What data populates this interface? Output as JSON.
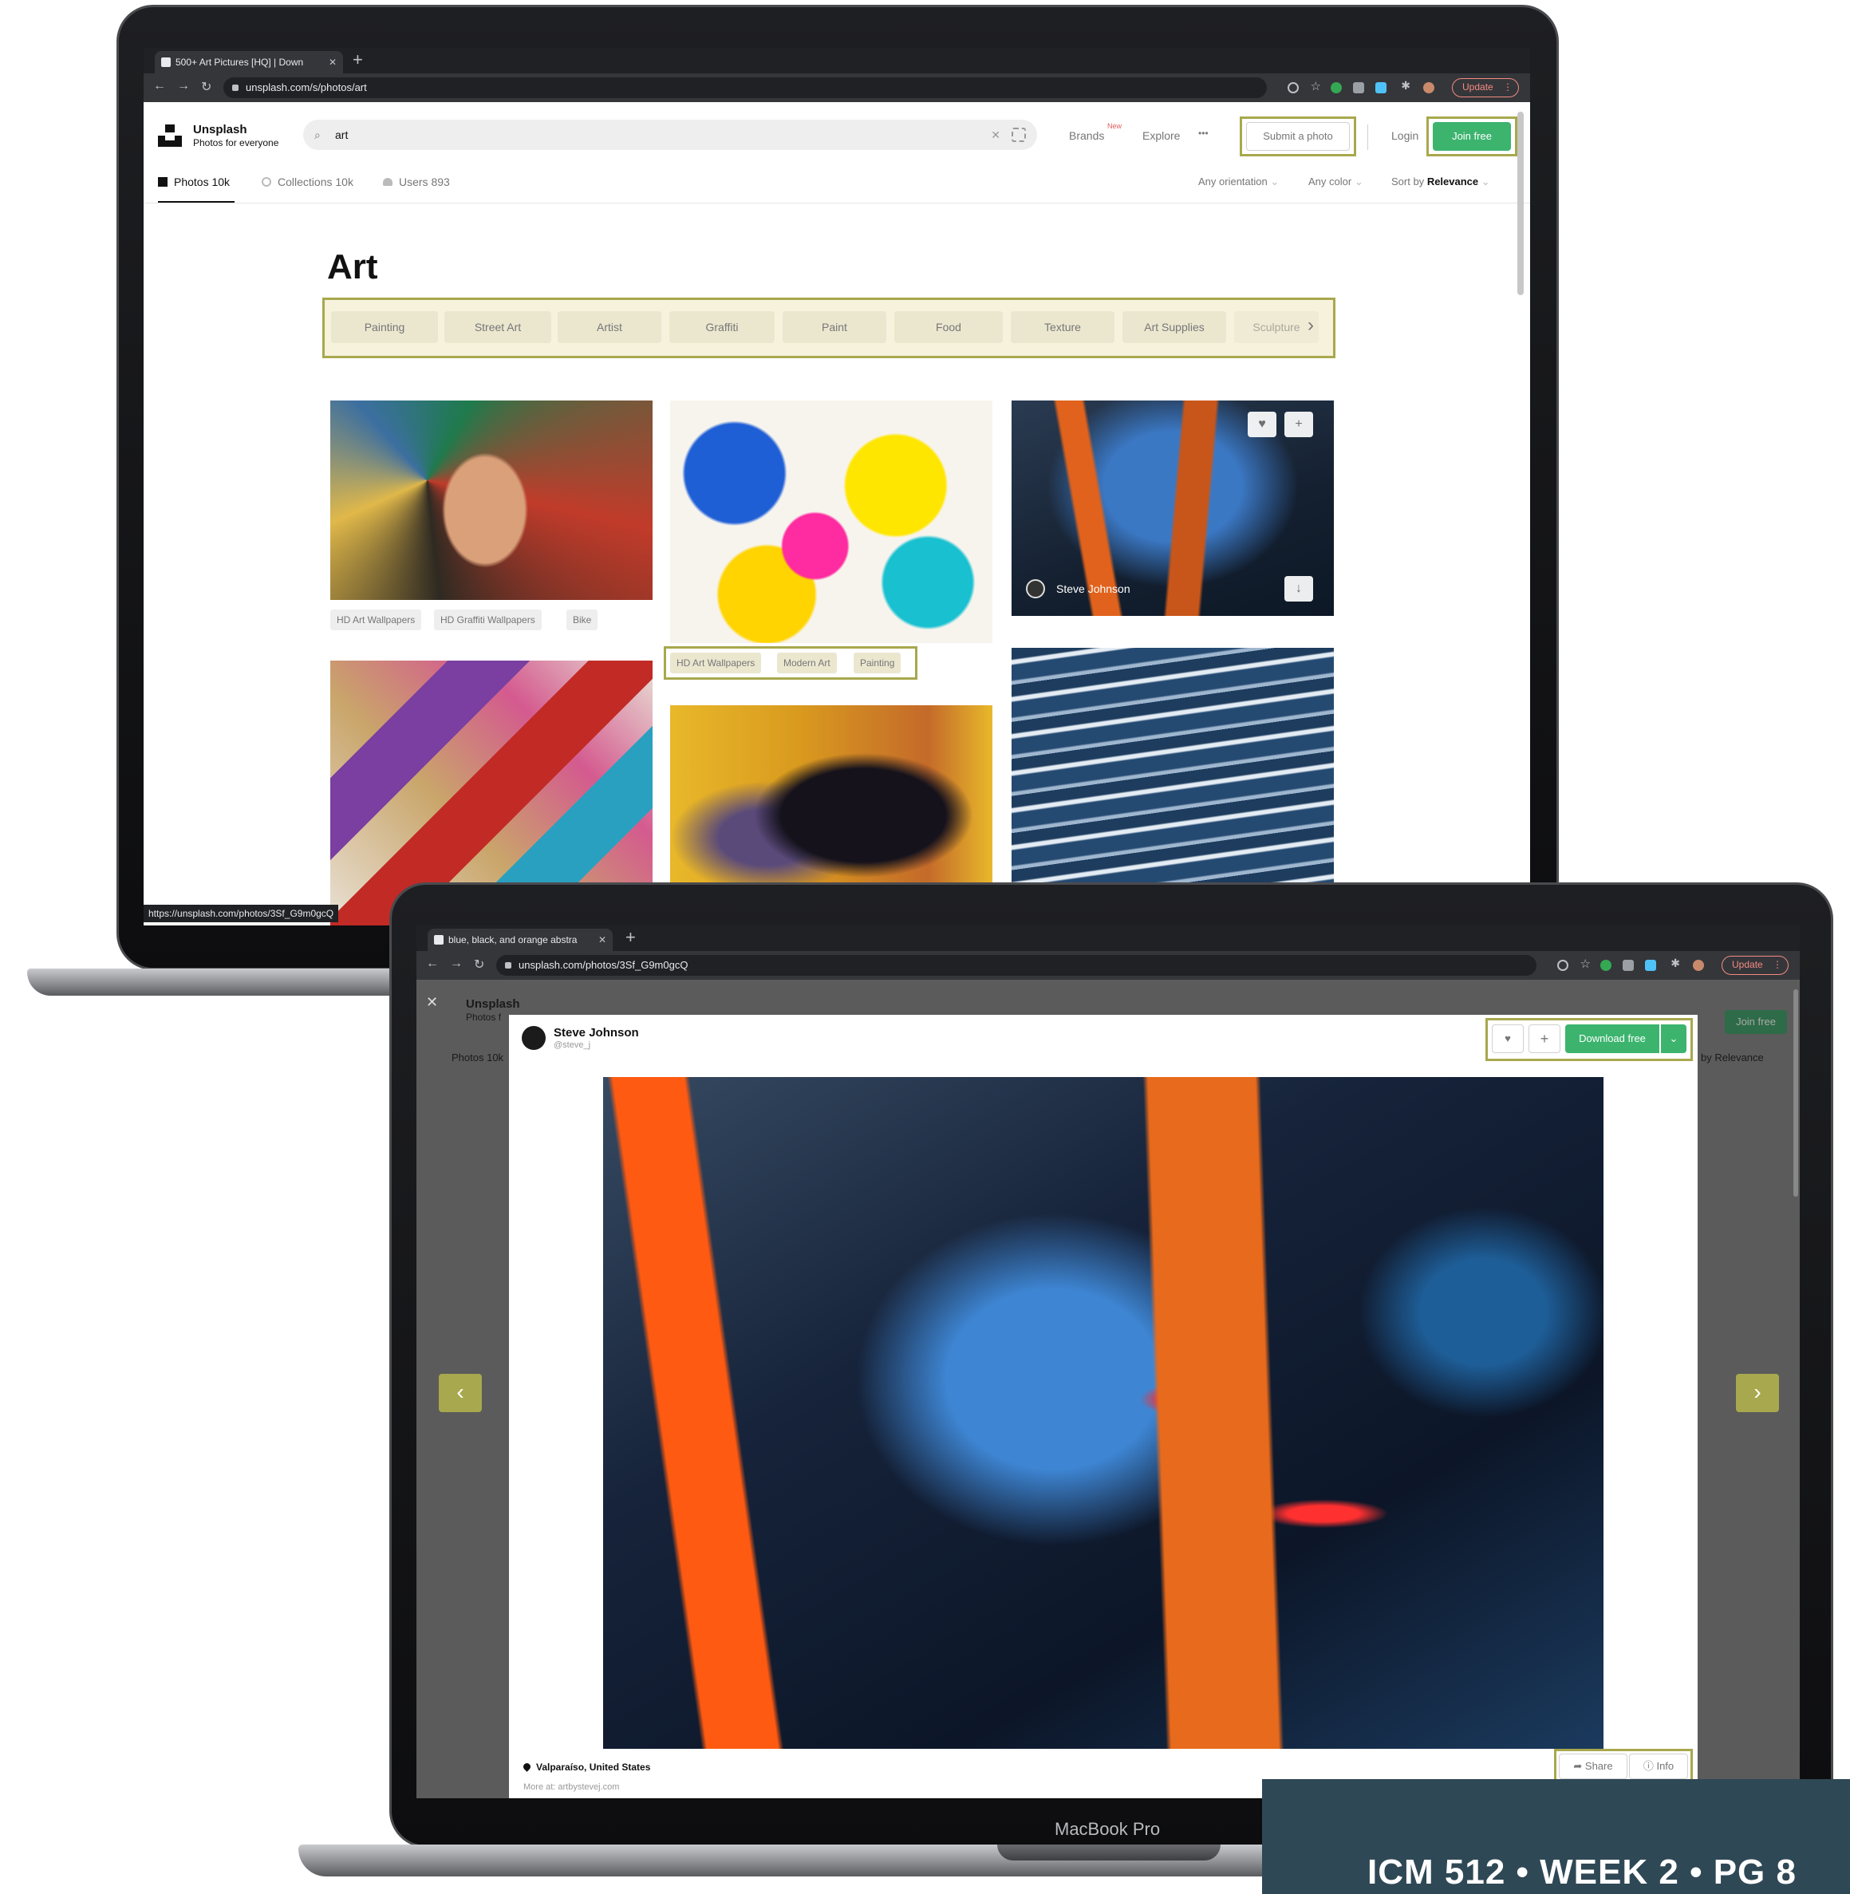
{
  "back_browser": {
    "tab_title": "500+ Art Pictures [HQ] | Down",
    "url": "unsplash.com/s/photos/art",
    "update_label": "Update",
    "status_url": "https://unsplash.com/photos/3Sf_G9m0gcQ"
  },
  "header": {
    "brand": "Unsplash",
    "tagline": "Photos for everyone",
    "search_value": "art",
    "brands_label": "Brands",
    "brands_badge": "New",
    "explore_label": "Explore",
    "more_label": "•••",
    "submit_label": "Submit a photo",
    "login_label": "Login",
    "join_label": "Join free"
  },
  "subnav": {
    "photos": "Photos 10k",
    "collections": "Collections 10k",
    "users": "Users 893",
    "orientation": "Any orientation",
    "color": "Any color",
    "sort_prefix": "Sort by",
    "sort_value": "Relevance"
  },
  "page_title": "Art",
  "chips": [
    "Painting",
    "Street Art",
    "Artist",
    "Graffiti",
    "Paint",
    "Food",
    "Texture",
    "Art Supplies",
    "Sculpture"
  ],
  "tags_col1": [
    "HD Art Wallpapers",
    "HD Graffiti Wallpapers",
    "Bike"
  ],
  "tags_col2": [
    "HD Art Wallpapers",
    "Modern Art",
    "Painting"
  ],
  "hover_author": "Steve Johnson",
  "front_browser": {
    "tab_title": "blue, black, and orange abstra",
    "url": "unsplash.com/photos/3Sf_G9m0gcQ",
    "update_label": "Update"
  },
  "modal": {
    "author": "Steve Johnson",
    "handle": "@steve_j",
    "download_label": "Download free",
    "location": "Valparaíso, United States",
    "more_at": "More at: artbystevej.com",
    "share_label": "Share",
    "info_label": "Info",
    "bg_photos": "Photos 10k",
    "bg_sort": "by Relevance",
    "bg_join": "Join free",
    "bg_brand": "Unsplash",
    "bg_tagline": "Photos f"
  },
  "laptop_label": "MacBook Pro",
  "footer_text": "ICM 512 • WEEK 2 • PG 8",
  "colors": {
    "accent_highlight": "#a8a84e",
    "unsplash_green": "#3cb46e",
    "footer_band": "#2f4855"
  }
}
